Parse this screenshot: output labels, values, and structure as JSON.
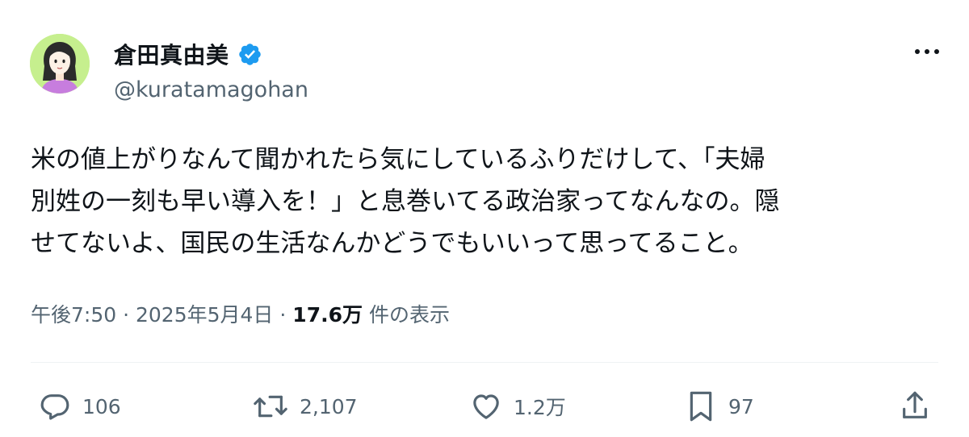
{
  "author": {
    "display_name": "倉田真由美",
    "handle": "@kuratamagohan",
    "verified_color": "#1d9bf0"
  },
  "tweet": {
    "lines": [
      "米の値上がりなんて聞かれたら気にしているふりだけして、「夫婦",
      "別姓の一刻も早い導入を！」と息巻いてる政治家ってなんなの。隠",
      "せてないよ、国民の生活なんかどうでもいいって思ってること。"
    ]
  },
  "meta": {
    "time": "午後7:50",
    "separator": "·",
    "date": "2025年5月4日",
    "views_count": "17.6万",
    "views_label": "件の表示"
  },
  "actions": {
    "replies": "106",
    "retweets": "2,107",
    "likes": "1.2万",
    "bookmarks": "97"
  },
  "icons": {
    "more": "more-horizontal-icon",
    "reply": "reply-icon",
    "retweet": "retweet-icon",
    "like": "heart-icon",
    "bookmark": "bookmark-icon",
    "share": "share-icon"
  }
}
